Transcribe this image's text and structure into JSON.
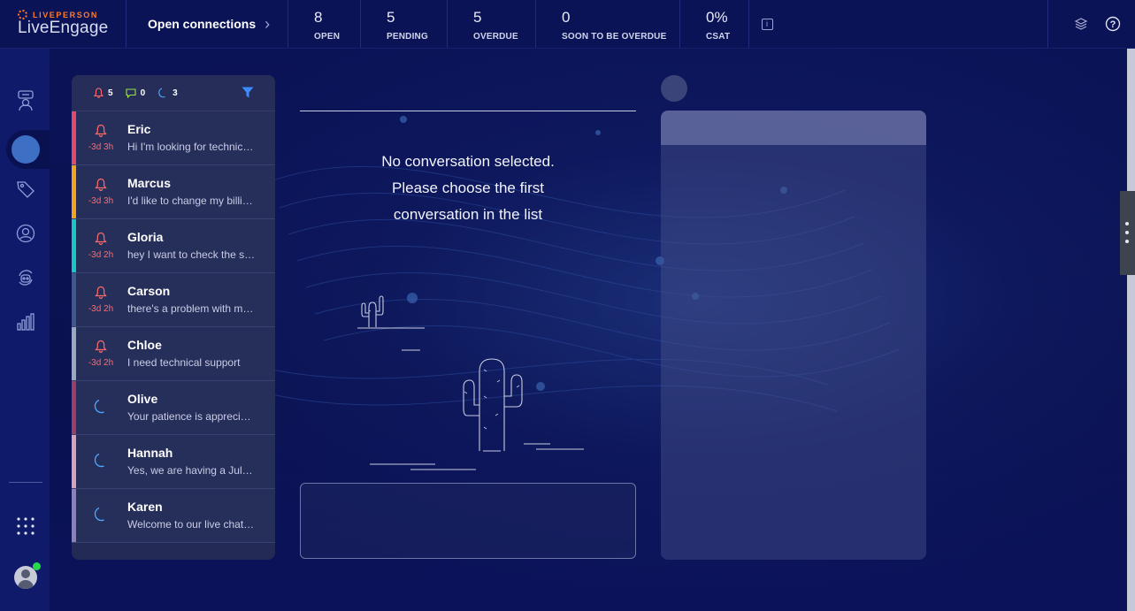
{
  "app": {
    "brand_top": "LIVEPERSON",
    "brand_main": "LiveEngage",
    "open_connections_label": "Open connections",
    "stats": [
      {
        "value": "8",
        "label": "OPEN"
      },
      {
        "value": "5",
        "label": "PENDING"
      },
      {
        "value": "5",
        "label": "OVERDUE"
      },
      {
        "value": "0",
        "label": "SOON TO BE OVERDUE"
      },
      {
        "value": "0%",
        "label": "CSAT"
      }
    ],
    "info_icon": "i"
  },
  "colors": {
    "brand_orange": "#ff7a2a",
    "alert_red": "#ff6a6a",
    "moon_blue": "#4fa9ff",
    "filter_blue": "#3d8bff",
    "message_green": "#9be24a",
    "online_green": "#26d94c"
  },
  "conversation_list": {
    "counts": {
      "alerts": "5",
      "messages": "0",
      "away": "3"
    },
    "items": [
      {
        "name": "Eric",
        "message": "Hi I'm looking for technical support",
        "time": "-3d 3h",
        "status": "alert",
        "stripe": "#e2496b"
      },
      {
        "name": "Marcus",
        "message": "I'd like to change my billing address",
        "time": "-3d 3h",
        "status": "alert",
        "stripe": "#f3a51a"
      },
      {
        "name": "Gloria",
        "message": "hey I want to check the status",
        "time": "-3d 2h",
        "status": "alert",
        "stripe": "#17c7c0"
      },
      {
        "name": "Carson",
        "message": "there's a problem with my account",
        "time": "-3d 2h",
        "status": "alert",
        "stripe": "#3d5a8a"
      },
      {
        "name": "Chloe",
        "message": "I need technical support",
        "time": "-3d 2h",
        "status": "alert",
        "stripe": "#9aa7bd"
      },
      {
        "name": "Olive",
        "message": "Your patience is appreciated",
        "time": "",
        "status": "away",
        "stripe": "#9a3f6a"
      },
      {
        "name": "Hannah",
        "message": "Yes, we are having a July sale",
        "time": "",
        "status": "away",
        "stripe": "#d6a3b8"
      },
      {
        "name": "Karen",
        "message": "Welcome to our live chat service",
        "time": "",
        "status": "away",
        "stripe": "#8f7fb8"
      }
    ]
  },
  "main": {
    "empty_line1": "No conversation selected.",
    "empty_line2": "Please choose the first",
    "empty_line3": "conversation in the list"
  },
  "icons": {
    "nav": [
      "agent-chat-icon",
      "tag-icon",
      "user-circle-icon",
      "bot-icon",
      "bar-chart-icon",
      "apps-grid-icon"
    ],
    "top_right": [
      "layers-icon",
      "help-icon"
    ]
  }
}
